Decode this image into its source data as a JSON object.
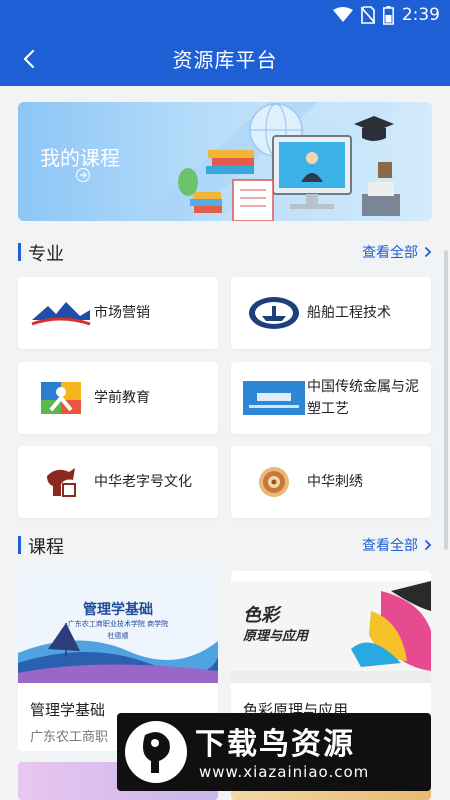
{
  "status_bar": {
    "time": "2:39",
    "icons": [
      "wifi-icon",
      "no-sim-icon",
      "battery-icon"
    ]
  },
  "app_bar": {
    "title": "资源库平台",
    "back_icon": "back-arrow-icon"
  },
  "banner": {
    "label": "我的课程",
    "arrow_icon": "circle-arrow-icon"
  },
  "majors": {
    "title": "专业",
    "more": "查看全部",
    "items": [
      {
        "name": "市场营销",
        "icon": "market-logo-icon"
      },
      {
        "name": "船舶工程技术",
        "icon": "ship-logo-icon"
      },
      {
        "name": "学前教育",
        "icon": "preschool-logo-icon"
      },
      {
        "name": "中国传统金属与泥塑工艺",
        "icon": "metal-craft-logo-icon"
      },
      {
        "name": "中华老字号文化",
        "icon": "brand-culture-logo-icon"
      },
      {
        "name": "中华刺绣",
        "icon": "embroidery-logo-icon"
      }
    ]
  },
  "courses": {
    "title": "课程",
    "more": "查看全部",
    "items": [
      {
        "title": "管理学基础",
        "subtitle": "广东农工商职",
        "thumb_title": "管理学基础",
        "thumb_school": "广东农工商职业技术学院  商学院",
        "thumb_teacher": "杜德顺"
      },
      {
        "title": "色彩原理与应用",
        "subtitle": "",
        "thumb_title": "色彩",
        "thumb_subtitle": "原理与应用"
      }
    ]
  },
  "watermark": {
    "main": "下载鸟资源",
    "url": "www.xiazainiao.com"
  },
  "colors": {
    "primary": "#1f5fd6",
    "background": "#f2f3f5",
    "card": "#ffffff"
  }
}
